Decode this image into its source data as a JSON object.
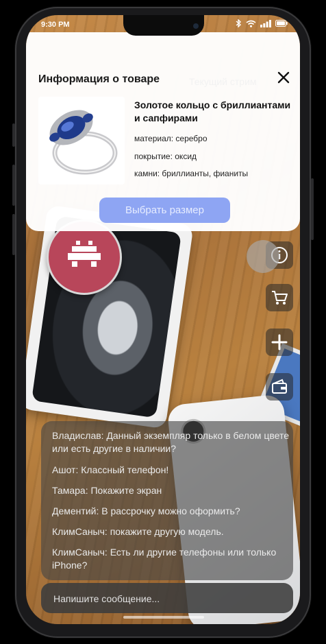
{
  "status_bar": {
    "time": "9:30 PM"
  },
  "product_panel": {
    "title": "Информация о товаре",
    "background_caption": "Текущий стрим",
    "product_name": "Золотое кольцо с бриллиантами и сапфирами",
    "specs": [
      "материал: серебро",
      "покрытие: оксид",
      "камни: бриллианты, фианиты"
    ],
    "select_size_label": "Выбрать размер"
  },
  "side_actions": [
    {
      "name": "info",
      "icon": "info-icon"
    },
    {
      "name": "cart",
      "icon": "cart-icon"
    },
    {
      "name": "add",
      "icon": "plus-icon"
    },
    {
      "name": "wallet",
      "icon": "wallet-icon"
    }
  ],
  "chat": {
    "messages": [
      "Владислав: Данный экземпляр только в белом цвете или есть другие в наличии?",
      "Ашот: Классный телефон!",
      "Тамара: Покажите экран",
      "Дементий: В рассрочку можно оформить?",
      "КлимСаныч: покажите другую модель.",
      "КлимСаныч: Есть ли другие  телефоны или только iPhone?"
    ],
    "input_placeholder": "Напишите сообщение..."
  },
  "colors": {
    "accent_button": "#8ea5f3",
    "card_bg": "#ffffff",
    "chat_bg": "#464646"
  }
}
